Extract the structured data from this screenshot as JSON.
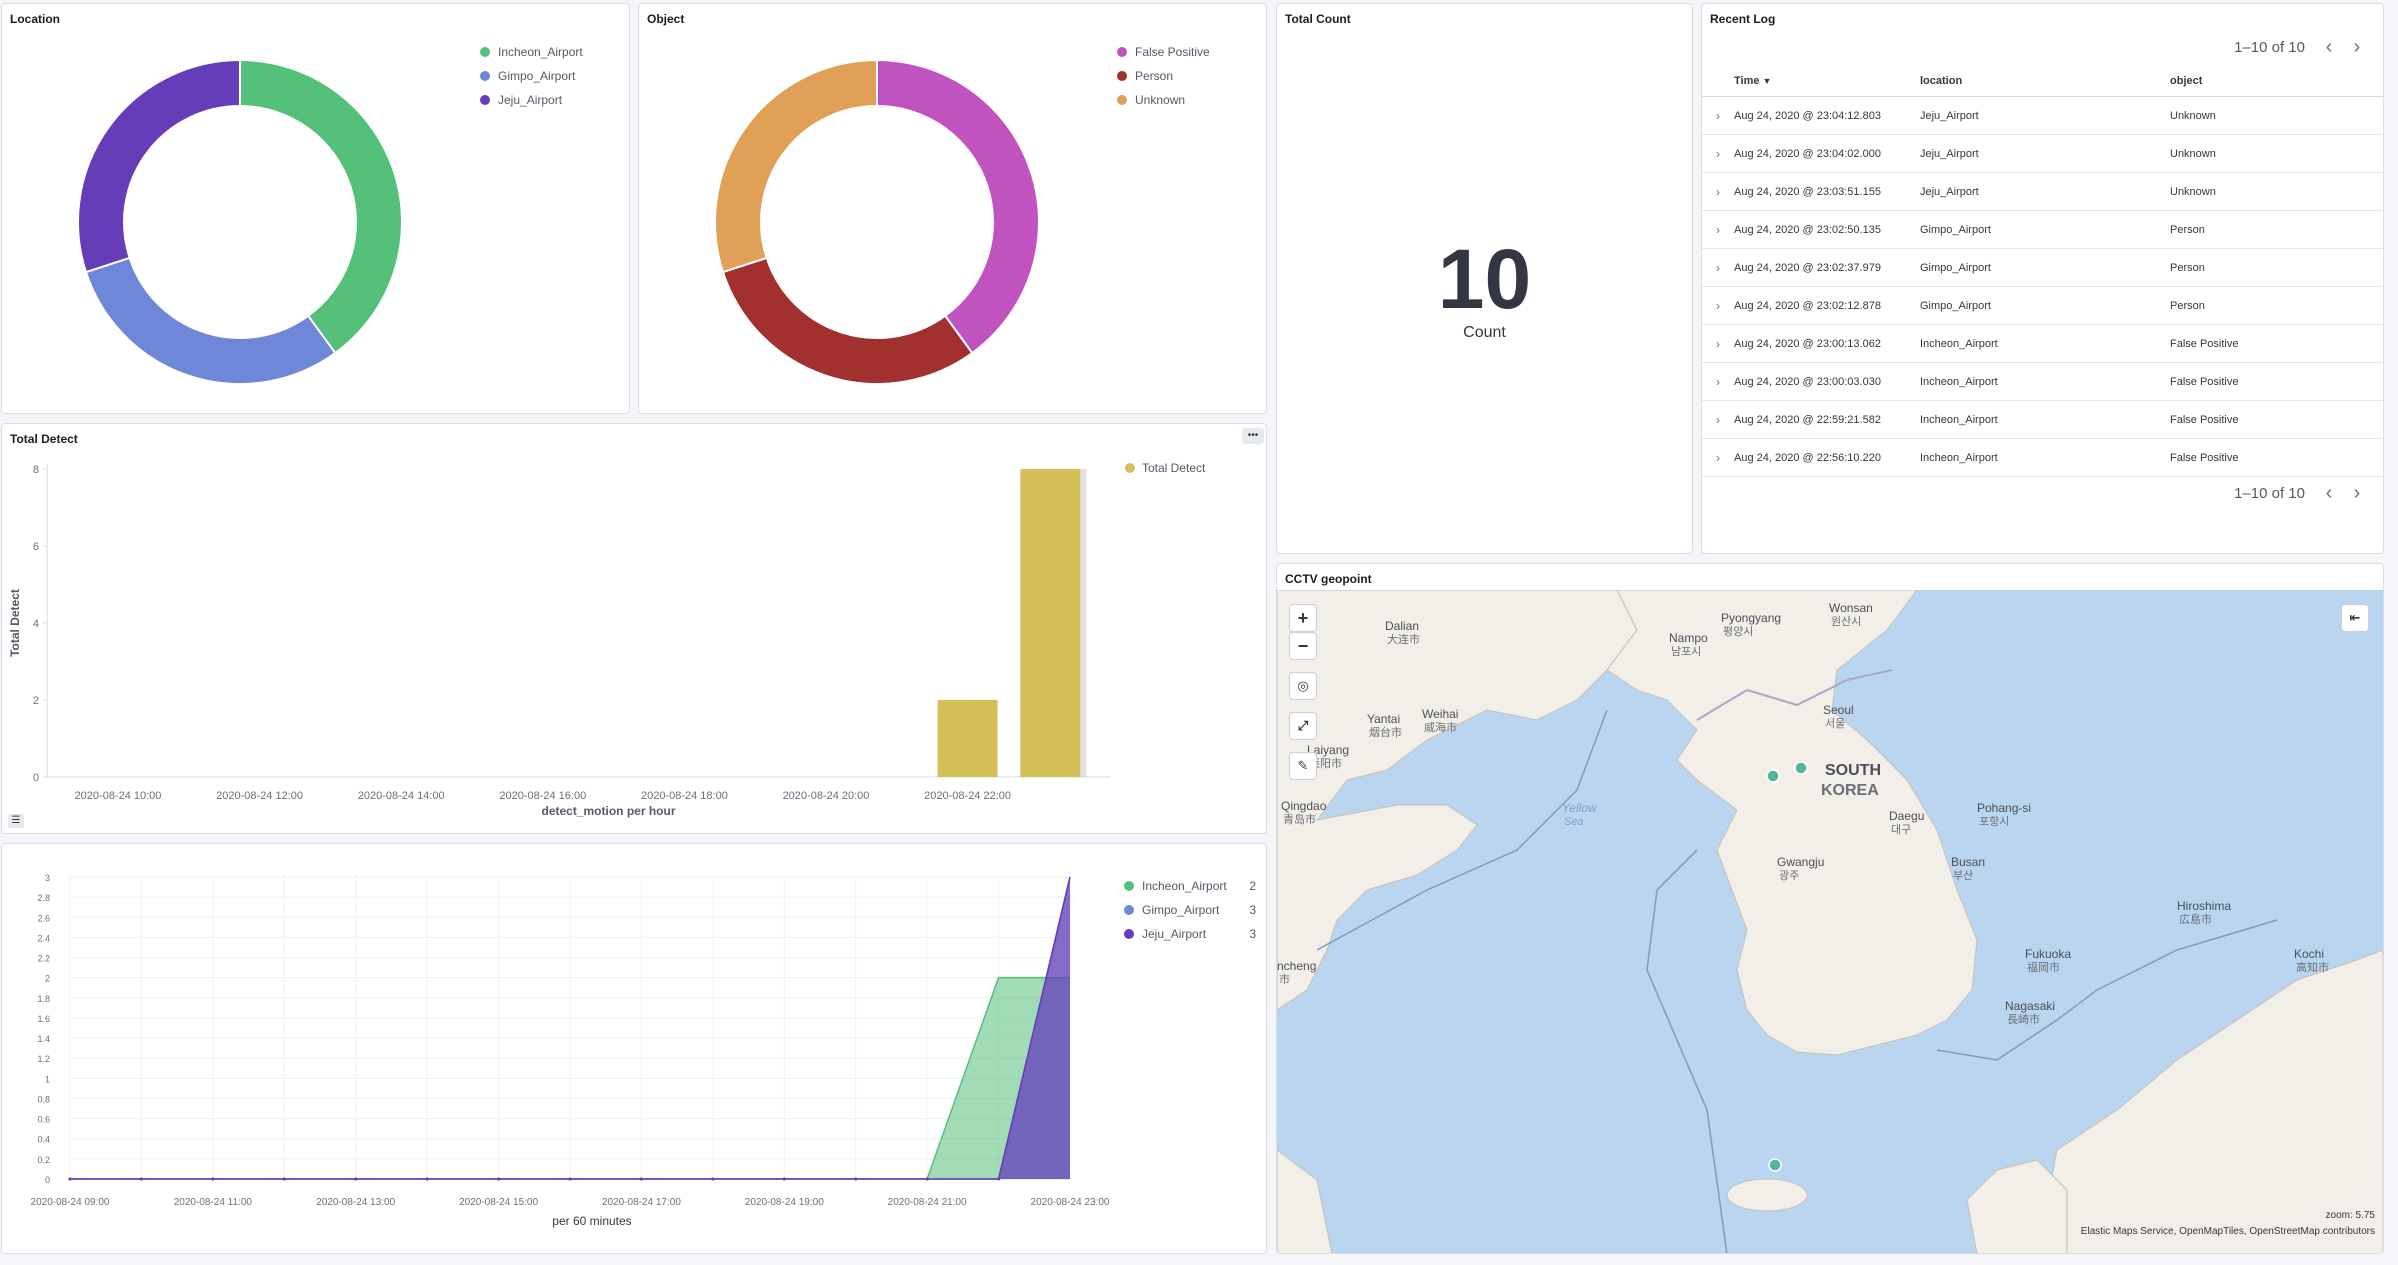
{
  "panels": {
    "location": {
      "title": "Location",
      "legend": [
        {
          "label": "Incheon_Airport",
          "color": "#54c07a"
        },
        {
          "label": "Gimpo_Airport",
          "color": "#6f87d8"
        },
        {
          "label": "Jeju_Airport",
          "color": "#663db8"
        }
      ]
    },
    "object": {
      "title": "Object",
      "legend": [
        {
          "label": "False Positive",
          "color": "#c153c0"
        },
        {
          "label": "Person",
          "color": "#a1302f"
        },
        {
          "label": "Unknown",
          "color": "#e0a057"
        }
      ]
    },
    "total_count": {
      "title": "Total Count",
      "value": "10",
      "label": "Count"
    },
    "recent_log": {
      "title": "Recent Log",
      "pagination": "1–10 of 10",
      "columns": [
        "Time",
        "location",
        "object"
      ],
      "rows": [
        [
          "Aug 24, 2020 @ 23:04:12.803",
          "Jeju_Airport",
          "Unknown"
        ],
        [
          "Aug 24, 2020 @ 23:04:02.000",
          "Jeju_Airport",
          "Unknown"
        ],
        [
          "Aug 24, 2020 @ 23:03:51.155",
          "Jeju_Airport",
          "Unknown"
        ],
        [
          "Aug 24, 2020 @ 23:02:50.135",
          "Gimpo_Airport",
          "Person"
        ],
        [
          "Aug 24, 2020 @ 23:02:37.979",
          "Gimpo_Airport",
          "Person"
        ],
        [
          "Aug 24, 2020 @ 23:02:12.878",
          "Gimpo_Airport",
          "Person"
        ],
        [
          "Aug 24, 2020 @ 23:00:13.062",
          "Incheon_Airport",
          "False Positive"
        ],
        [
          "Aug 24, 2020 @ 23:00:03.030",
          "Incheon_Airport",
          "False Positive"
        ],
        [
          "Aug 24, 2020 @ 22:59:21.582",
          "Incheon_Airport",
          "False Positive"
        ],
        [
          "Aug 24, 2020 @ 22:56:10.220",
          "Incheon_Airport",
          "False Positive"
        ]
      ]
    },
    "total_detect": {
      "title": "Total Detect",
      "menu": "•••"
    },
    "map": {
      "title": "CCTV geopoint",
      "labels": [
        {
          "en": "Dalian",
          "ko": "大连市"
        },
        {
          "en": "Pyongyang",
          "ko": "평양시"
        },
        {
          "en": "Wonsan",
          "ko": "원산시"
        },
        {
          "en": "Nampo",
          "ko": "남포시"
        },
        {
          "en": "Weihai",
          "ko": "威海市"
        },
        {
          "en": "Yantai",
          "ko": "烟台市"
        },
        {
          "en": "Seoul",
          "ko": "서울"
        },
        {
          "en": "Laiyang",
          "ko": "莱阳市"
        },
        {
          "en": "SOUTH",
          "ko": "KOREA"
        },
        {
          "en": "Qingdao",
          "ko": "青岛市"
        },
        {
          "en": "Pohang-si",
          "ko": "포항시"
        },
        {
          "en": "Daegu",
          "ko": "대구"
        },
        {
          "en": "Gwangju",
          "ko": "광주"
        },
        {
          "en": "Busan",
          "ko": "부산"
        },
        {
          "en": "Hiroshima",
          "ko": "広島市"
        },
        {
          "en": "Fukuoka",
          "ko": "福岡市"
        },
        {
          "en": "Kochi",
          "ko": "高知市"
        },
        {
          "en": "Nagasaki",
          "ko": "長崎市"
        },
        {
          "en": "Yellow",
          "ko": "Sea"
        },
        {
          "en": "nchеng",
          "ko": "市"
        }
      ],
      "attribution": "Elastic Maps Service, OpenMapTiles, OpenStreetMap contributors",
      "zoom": "zoom: 5.75"
    }
  },
  "chart_data": [
    {
      "type": "pie",
      "title": "Location",
      "labels": [
        "Incheon_Airport",
        "Gimpo_Airport",
        "Jeju_Airport"
      ],
      "values": [
        4,
        3,
        3
      ],
      "donut": true,
      "colors": [
        "#54c07a",
        "#6f87d8",
        "#663db8"
      ],
      "legend": "top-right"
    },
    {
      "type": "pie",
      "title": "Object",
      "labels": [
        "False Positive",
        "Person",
        "Unknown"
      ],
      "values": [
        4,
        3,
        3
      ],
      "donut": true,
      "colors": [
        "#c153c0",
        "#a1302f",
        "#e0a057"
      ],
      "legend": "top-right"
    },
    {
      "type": "bar",
      "title": "Total Detect",
      "x": [
        "2020-08-24 22:00",
        "2020-08-24 23:00"
      ],
      "values": [
        2,
        8
      ],
      "xticks": [
        "2020-08-24 10:00",
        "2020-08-24 12:00",
        "2020-08-24 14:00",
        "2020-08-24 16:00",
        "2020-08-24 18:00",
        "2020-08-24 20:00",
        "2020-08-24 22:00"
      ],
      "yticks": [
        0,
        2,
        4,
        6,
        8
      ],
      "xlabel": "detect_motion per hour",
      "ylabel": "Total Detect",
      "ylim": [
        0,
        8
      ],
      "series_name": "Total Detect",
      "color": "#d6bf57",
      "legend": "top-right"
    },
    {
      "type": "area",
      "xticks": [
        "2020-08-24 09:00",
        "2020-08-24 11:00",
        "2020-08-24 13:00",
        "2020-08-24 15:00",
        "2020-08-24 17:00",
        "2020-08-24 19:00",
        "2020-08-24 21:00",
        "2020-08-24 23:00"
      ],
      "yticks": [
        0,
        0.2,
        0.4,
        0.6,
        0.8,
        1,
        1.2,
        1.4,
        1.6,
        1.8,
        2,
        2.2,
        2.4,
        2.6,
        2.8,
        3
      ],
      "xlabel": "per 60 minutes",
      "ylim": [
        0,
        3
      ],
      "hours": [
        9,
        10,
        11,
        12,
        13,
        14,
        15,
        16,
        17,
        18,
        19,
        20,
        21,
        22,
        23
      ],
      "series": [
        {
          "name": "Incheon_Airport",
          "legend_value": "2",
          "color": "#54c07a",
          "values": [
            0,
            0,
            0,
            0,
            0,
            0,
            0,
            0,
            0,
            0,
            0,
            0,
            0,
            2,
            2
          ]
        },
        {
          "name": "Gimpo_Airport",
          "legend_value": "3",
          "color": "#6f87d8",
          "values": [
            0,
            0,
            0,
            0,
            0,
            0,
            0,
            0,
            0,
            0,
            0,
            0,
            0,
            0,
            3
          ]
        },
        {
          "name": "Jeju_Airport",
          "legend_value": "3",
          "color": "#663db8",
          "values": [
            0,
            0,
            0,
            0,
            0,
            0,
            0,
            0,
            0,
            0,
            0,
            0,
            0,
            0,
            3
          ]
        }
      ],
      "legend": "top-right"
    }
  ]
}
